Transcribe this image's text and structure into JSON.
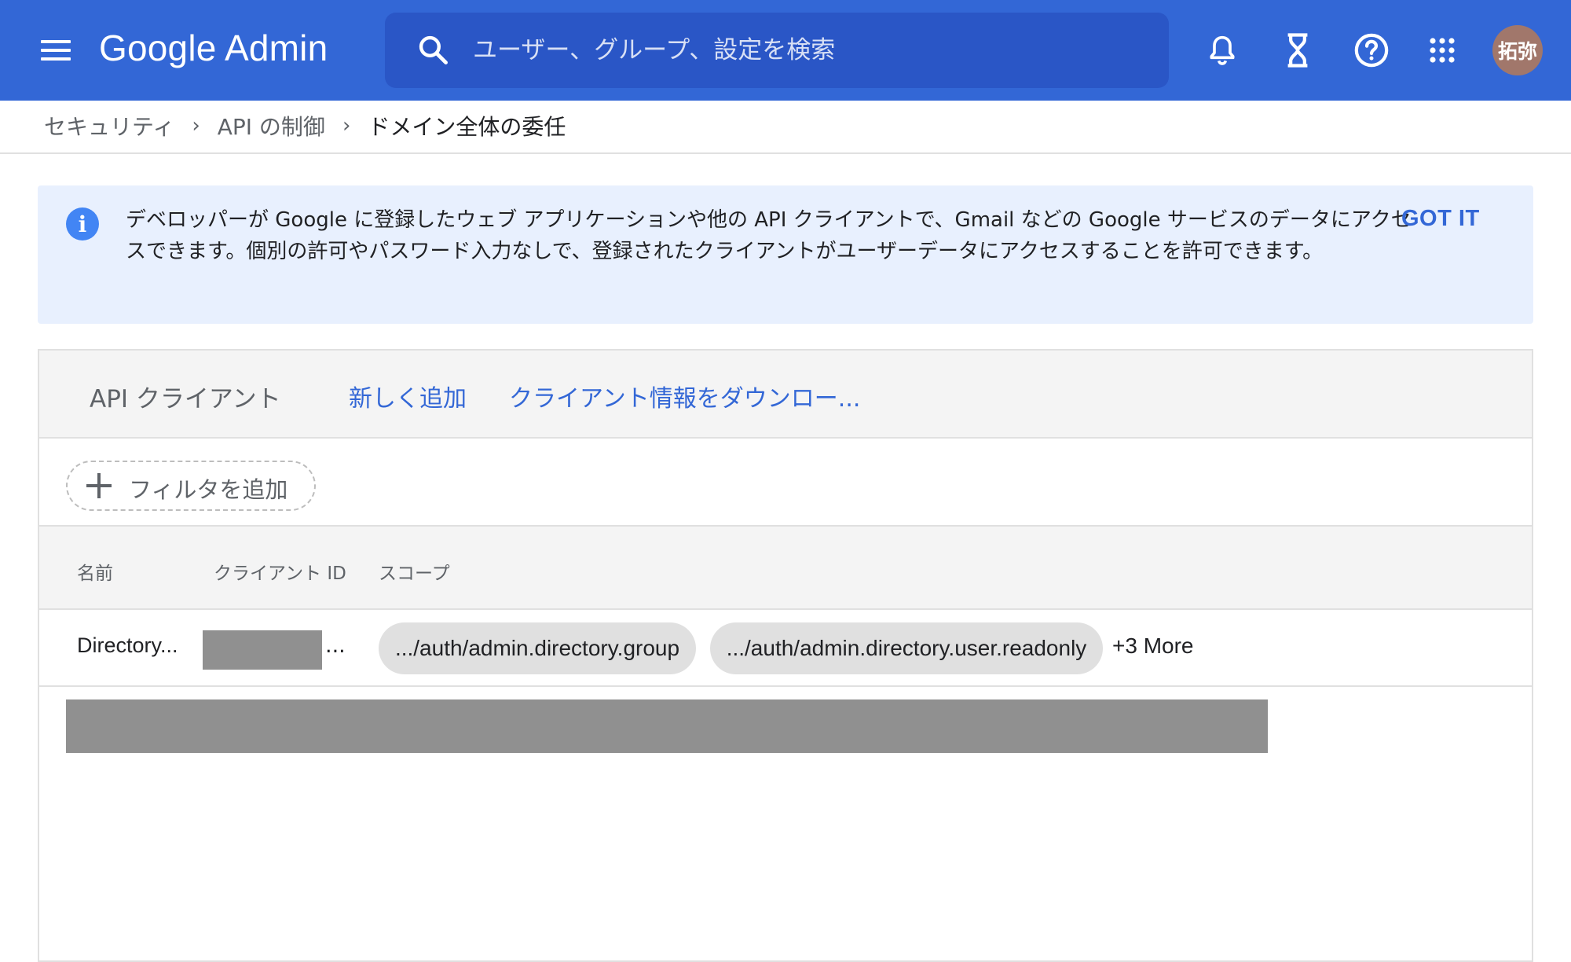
{
  "app": {
    "brand": "Google Admin",
    "menu_icon": "hamburger-menu-icon"
  },
  "search": {
    "placeholder": "ユーザー、グループ、設定を検索",
    "icon": "search-icon"
  },
  "topbar_icons": [
    "bell-notifications-icon",
    "hourglass-tasks-icon",
    "help-circle-icon",
    "apps-grid-icon"
  ],
  "user": {
    "avatar_text": "拓弥",
    "avatar_color": "#a1776b"
  },
  "breadcrumb": {
    "items": [
      {
        "label": "セキュリティ"
      },
      {
        "label": "API の制御"
      },
      {
        "label": "ドメイン全体の委任"
      }
    ],
    "separator": "›"
  },
  "banner": {
    "icon": "info-icon",
    "text": "デベロッパーが Google に登録したウェブ アプリケーションや他の API クライアントで、Gmail などの Google サービスのデータにアクセスできます。個別の許可やパスワード入力なしで、登録されたクライアントがユーザーデータにアクセスすることを許可できます。",
    "action_label": "GOT IT"
  },
  "card": {
    "title": "API クライアント",
    "add_new_label": "新しく追加",
    "download_label": "クライアント情報をダウンロー..."
  },
  "filter": {
    "add_label": "フィルタを追加"
  },
  "table": {
    "columns": [
      "名前",
      "クライアント ID",
      "スコープ"
    ],
    "rows": [
      {
        "name": "Directory...",
        "client_id_suffix": "...",
        "scopes": [
          ".../auth/admin.directory.group",
          ".../auth/admin.directory.user.readonly"
        ],
        "more_label": "+3 More"
      }
    ]
  },
  "colors": {
    "topbar": "#3367d6",
    "searchbox": "#2a56c6",
    "banner_bg": "#e8f0fe",
    "link": "#3367d6",
    "redaction": "#909090"
  }
}
